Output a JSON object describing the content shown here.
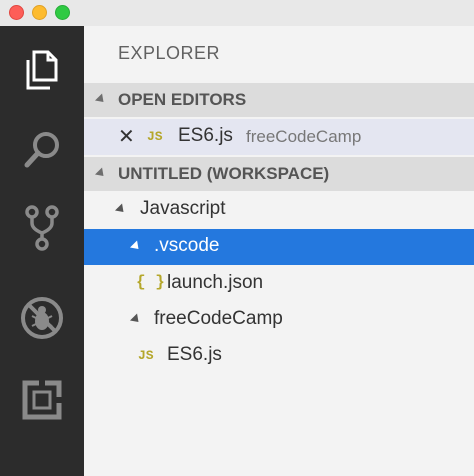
{
  "window": {
    "controls": [
      "close",
      "minimize",
      "maximize"
    ]
  },
  "activity_bar": {
    "icons": [
      "files-icon",
      "search-icon",
      "source-control-icon",
      "debug-icon",
      "extensions-icon"
    ]
  },
  "sidebar": {
    "title": "EXPLORER",
    "open_editors": {
      "header": "OPEN EDITORS",
      "items": [
        {
          "close": "✕",
          "badge": "JS",
          "name": "ES6.js",
          "description": "freeCodeCamp"
        }
      ]
    },
    "workspace": {
      "header": "UNTITLED (WORKSPACE)",
      "tree": [
        {
          "name": "Javascript",
          "type": "folder"
        },
        {
          "name": ".vscode",
          "type": "folder",
          "selected": true
        },
        {
          "badge": "{ }",
          "name": "launch.json",
          "type": "file"
        },
        {
          "name": "freeCodeCamp",
          "type": "folder"
        },
        {
          "badge": "JS",
          "name": "ES6.js",
          "type": "file"
        }
      ]
    }
  },
  "colors": {
    "activity_bar": "#2c2c2c",
    "selection": "#2478de",
    "section_header": "#dcdcdc",
    "js_badge": "#b5a72b"
  }
}
